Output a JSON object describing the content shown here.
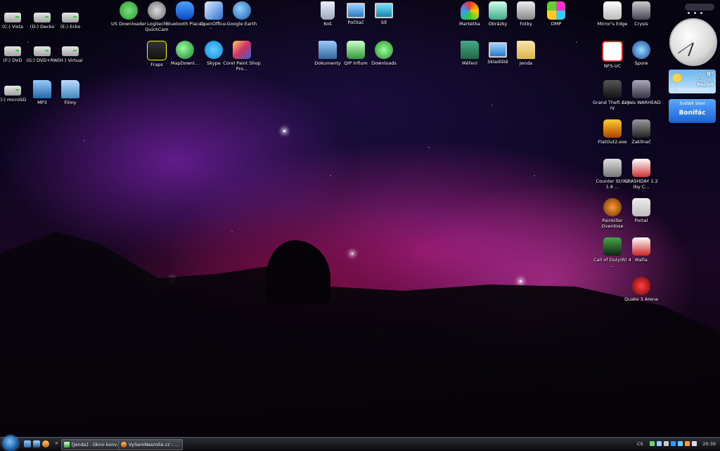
{
  "desktop_icons": [
    {
      "label": "(C:) Vista",
      "icon": "drive-icon"
    },
    {
      "label": "(D:) Decko",
      "icon": "drive-icon"
    },
    {
      "label": "(E:) Ecko",
      "icon": "drive-icon"
    },
    {
      "label": "US Downloader",
      "icon": "downloader-icon"
    },
    {
      "label": "Logitech QuickCam",
      "icon": "webcam-icon"
    },
    {
      "label": "Bluetooth Places",
      "icon": "bluetooth-icon"
    },
    {
      "label": "OpenOffice-",
      "icon": "openoffice-icon"
    },
    {
      "label": "Google Earth",
      "icon": "globe-icon"
    },
    {
      "label": "Koš",
      "icon": "recycle-bin-icon"
    },
    {
      "label": "Počítač",
      "icon": "computer-icon"
    },
    {
      "label": "Síť",
      "icon": "network-icon"
    },
    {
      "label": "Markétka",
      "icon": "msn-butterfly-icon"
    },
    {
      "label": "Obrázky",
      "icon": "pictures-icon"
    },
    {
      "label": "Fotky",
      "icon": "camera-icon"
    },
    {
      "label": "DMP",
      "icon": "dmp-icon"
    },
    {
      "label": "Mirror's Edge",
      "icon": "game-icon"
    },
    {
      "label": "Crysis",
      "icon": "game-icon"
    },
    {
      "label": "(F:) DVD",
      "icon": "dvd-drive-icon"
    },
    {
      "label": "(G:) DVD+RW",
      "icon": "dvd-drive-icon"
    },
    {
      "label": "(H:) Virtual",
      "icon": "dvd-drive-icon"
    },
    {
      "label": "Fraps",
      "icon": "fraps-icon"
    },
    {
      "label": "MapDownl...",
      "icon": "globe-icon"
    },
    {
      "label": "Skype",
      "icon": "skype-icon"
    },
    {
      "label": "Corel Paint Shop Pro...",
      "icon": "paint-icon"
    },
    {
      "label": "Dokumenty",
      "icon": "documents-icon"
    },
    {
      "label": "QIP Infium",
      "icon": "chat-icon"
    },
    {
      "label": "Downloads",
      "icon": "downloads-icon"
    },
    {
      "label": "Měření",
      "icon": "folder-icon"
    },
    {
      "label": "Skladiště",
      "icon": "monitor-icon"
    },
    {
      "label": "Jenda",
      "icon": "folder-icon"
    },
    {
      "label": "NFS-UC",
      "icon": "game-icon"
    },
    {
      "label": "Spore",
      "icon": "spore-icon"
    },
    {
      "label": "(I:) microSD",
      "icon": "drive-icon"
    },
    {
      "label": "MP3",
      "icon": "music-folder-icon"
    },
    {
      "label": "Filmy",
      "icon": "video-folder-icon"
    },
    {
      "label": "Grand Theft Auto IV",
      "icon": "game-icon"
    },
    {
      "label": "Crysis WARHEAD",
      "icon": "game-icon"
    },
    {
      "label": "FlatOut2.exe",
      "icon": "game-icon"
    },
    {
      "label": "Zaklínač",
      "icon": "game-icon"
    },
    {
      "label": "Counter Strike 1.6 ...",
      "icon": "game-icon"
    },
    {
      "label": "CRASHDAY 1.2 (by C...",
      "icon": "game-icon"
    },
    {
      "label": "Painkiller Overdose",
      "icon": "game-icon"
    },
    {
      "label": "Portal",
      "icon": "game-icon"
    },
    {
      "label": "Call of Duty(R) 4 ...",
      "icon": "game-icon"
    },
    {
      "label": "Mafia",
      "icon": "game-icon"
    },
    {
      "label": "Quake 3 Arena",
      "icon": "game-icon"
    }
  ],
  "gadgets": {
    "weather": {
      "temp": "9°",
      "range": "13° - 6°",
      "city": "Nejdek",
      "footer": "© Weatherground"
    },
    "nameday": {
      "header": "Svátek slaví",
      "name": "Bonifác"
    }
  },
  "taskbar": {
    "chevron": "»",
    "windows": [
      {
        "label": "[Jenda] - Okno konv..."
      },
      {
        "label": "VySemNesmite.cz : ..."
      }
    ],
    "language": "CS",
    "time": "20:39"
  },
  "colors": {
    "accent": "#1a62d4",
    "taskbar": "#0b0c10"
  }
}
